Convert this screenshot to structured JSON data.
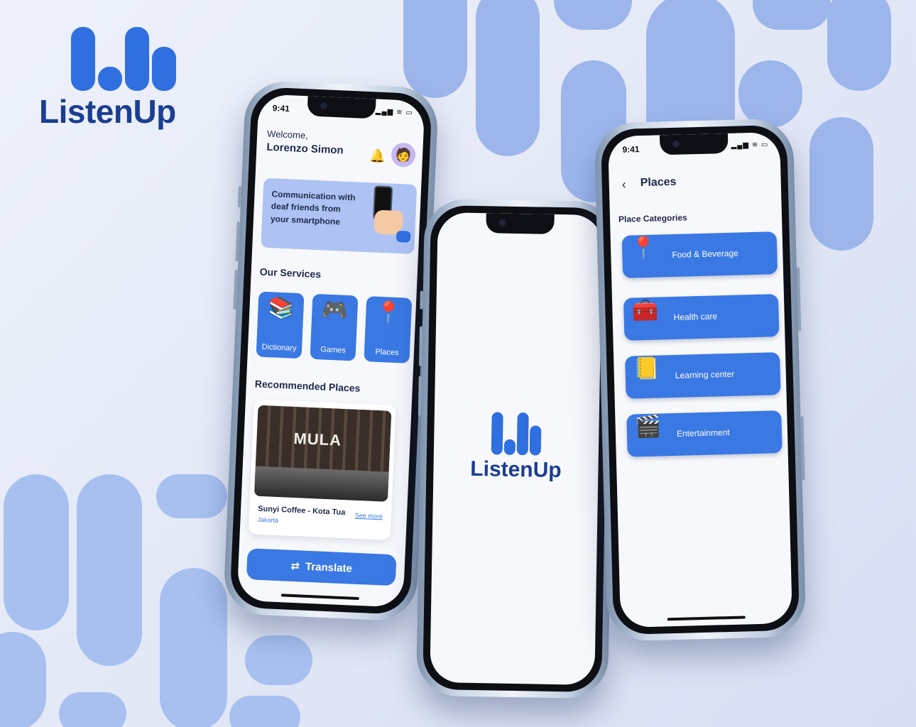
{
  "brand": {
    "name": "ListenUp"
  },
  "home": {
    "status_time": "9:41",
    "status_icons": "▂▄▆ ≋ ▭",
    "welcome": "Welcome,",
    "user_name": "Lorenzo Simon",
    "hero_text": "Communication with deaf friends from your smartphone",
    "services_title": "Our Services",
    "services": [
      {
        "label": "Dictionary",
        "icon": "books-icon"
      },
      {
        "label": "Games",
        "icon": "gamepad-icon"
      },
      {
        "label": "Places",
        "icon": "location-pin-icon"
      }
    ],
    "recommended_title": "Recommended Places",
    "recommended": {
      "sign": "MULA",
      "name": "Sunyi Coffee - Kota Tua",
      "city": "Jakarta",
      "see_more": "See more"
    },
    "translate_label": "Translate",
    "translate_icon": "⇄"
  },
  "splash": {
    "brand": "ListenUp"
  },
  "places": {
    "status_time": "9:41",
    "status_icons": "▂▄▆ ≋ ▭",
    "back_icon": "‹",
    "title": "Places",
    "categories_title": "Place Categories",
    "categories": [
      {
        "label": "Food & Beverage",
        "icon": "food-pin-icon"
      },
      {
        "label": "Health care",
        "icon": "first-aid-icon"
      },
      {
        "label": "Learning center",
        "icon": "notebook-icon"
      },
      {
        "label": "Entertainment",
        "icon": "clapperboard-icon"
      }
    ]
  },
  "colors": {
    "accent": "#3a78e4",
    "brand_dark": "#1b3e91",
    "pill": "#9cb6ec"
  }
}
